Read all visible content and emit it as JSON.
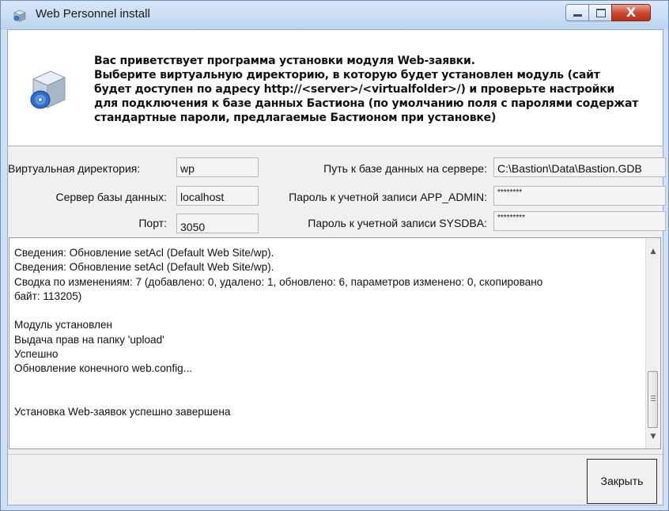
{
  "window": {
    "title": "Web Personnel install",
    "minimize_icon": "minimize-icon",
    "maximize_icon": "maximize-icon",
    "close_glyph": "X"
  },
  "header": {
    "icon": "installer-box-icon",
    "welcome_text": "Вас приветствует программа установки модуля Web-заявки.\nВыберите виртуальную директорию, в которую будет установлен модуль (сайт\nбудет доступен по адресу http://<server>/<virtualfolder>/) и проверьте настройки\nдля подключения к базе данных Бастиона (по умолчанию поля с паролями содержат\nстандартные пароли, предлагаемые Бастионом при установке)"
  },
  "form": {
    "virtual_dir_label": "Виртуальная директория:",
    "virtual_dir_value": "wp",
    "db_server_label": "Сервер базы данных:",
    "db_server_value": "localhost",
    "port_label": "Порт:",
    "port_value": "3050",
    "db_path_label": "Путь к базе данных на сервере:",
    "db_path_value": "C:\\Bastion\\Data\\Bastion.GDB",
    "app_admin_label": "Пароль к учетной записи APP_ADMIN:",
    "app_admin_value": "********",
    "sysdba_label": "Пароль к учетной записи SYSDBA:",
    "sysdba_value": "*********"
  },
  "log": {
    "text": "Сведения: Обновление setAcl (Default Web Site/wp).\nСведения: Обновление setAcl (Default Web Site/wp).\nСводка по изменениям: 7 (добавлено: 0, удалено: 1, обновлено: 6, параметров изменено: 0, скопировано\nбайт: 113205)\n\nМодуль установлен\nВыдача прав на папку 'upload'\nУспешно\nОбновление конечного web.config...\n\n\nУстановка Web-заявок успешно завершена"
  },
  "buttons": {
    "close_label": "Закрыть"
  }
}
